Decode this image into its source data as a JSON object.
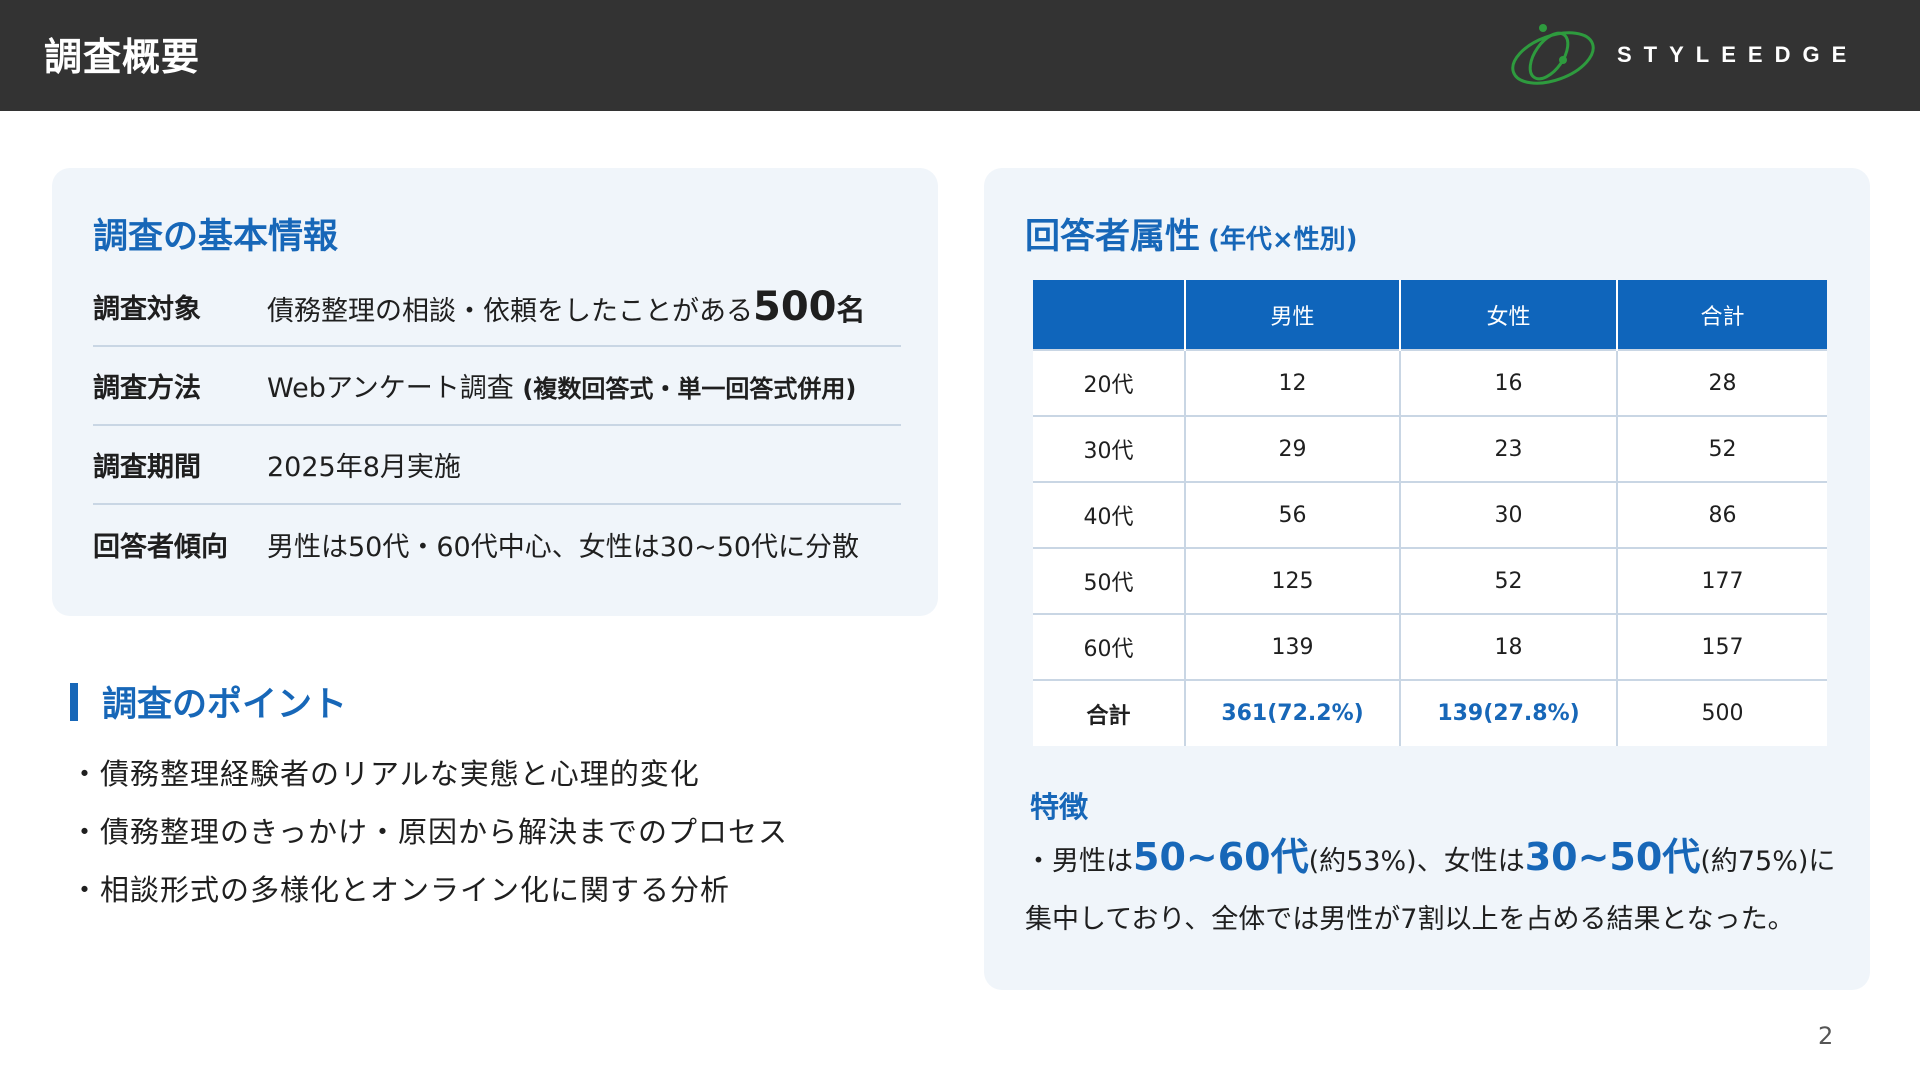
{
  "header": {
    "title": "調査概要",
    "logo_text": "STYLEEDGE",
    "logo_color": "#2e9b3e"
  },
  "basic_info": {
    "title": "調査の基本情報",
    "rows": [
      {
        "label": "調査対象",
        "value": "債務整理の相談・依頼をしたことがある",
        "emphasis": "500",
        "unit": "名"
      },
      {
        "label": "調査方法",
        "value": "Webアンケート調査",
        "note": "(複数回答式・単一回答式併用)"
      },
      {
        "label": "調査期間",
        "value": "2025年8月実施"
      },
      {
        "label": "回答者傾向",
        "value": "男性は50代・60代中心、女性は30~50代に分散"
      }
    ]
  },
  "points": {
    "title": "調査のポイント",
    "items": [
      "・債務整理経験者のリアルな実態と心理的変化",
      "・債務整理のきっかけ・原因から解決までのプロセス",
      "・相談形式の多様化とオンライン化に関する分析"
    ]
  },
  "attributes": {
    "title": "回答者属性",
    "subtitle": "(年代×性別)",
    "table": {
      "headers": [
        "",
        "男性",
        "女性",
        "合計"
      ],
      "rows": [
        [
          "20代",
          "12",
          "16",
          "28"
        ],
        [
          "30代",
          "29",
          "23",
          "52"
        ],
        [
          "40代",
          "56",
          "30",
          "86"
        ],
        [
          "50代",
          "125",
          "52",
          "177"
        ],
        [
          "60代",
          "139",
          "18",
          "157"
        ]
      ],
      "total": [
        "合計",
        "361(72.2%)",
        "139(27.8%)",
        "500"
      ]
    },
    "feature": {
      "title": "特徴",
      "p1": "・男性は",
      "h1": "50~60代",
      "p2": "(約53%)、女性は",
      "h2": "30~50代",
      "p3": "(約75%)に",
      "line2": "集中しており、全体では男性が7割以上を占める結果となった。"
    }
  },
  "page_number": "2",
  "colors": {
    "header_bg": "#333333",
    "accent_blue": "#1767b8",
    "table_header": "#0f65bb",
    "card_bg": "#f0f5fa"
  }
}
